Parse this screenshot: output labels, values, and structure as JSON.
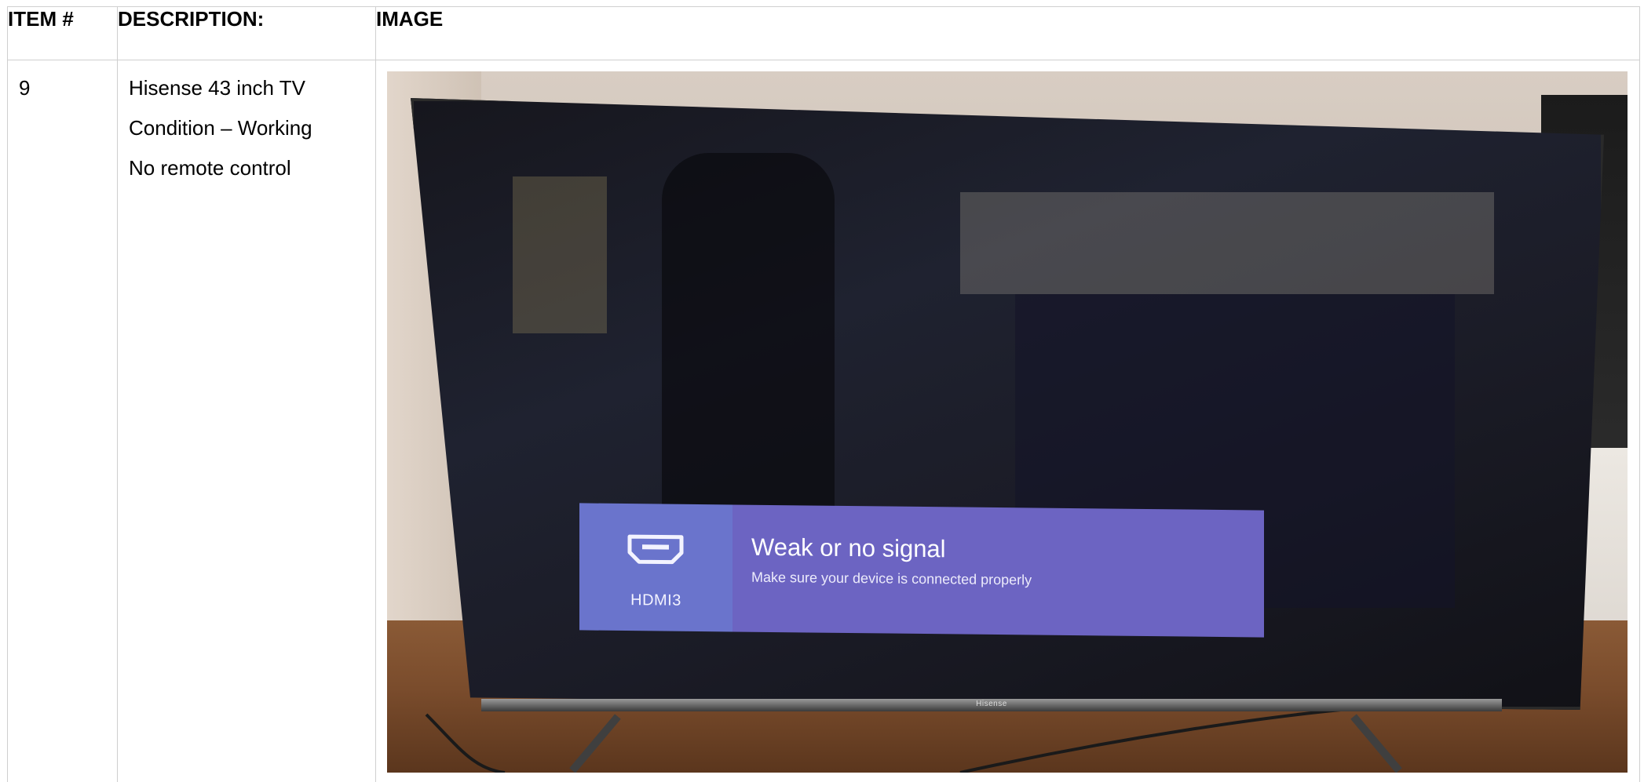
{
  "table": {
    "headers": {
      "item": "ITEM #",
      "description": "DESCRIPTION:",
      "image": "IMAGE"
    },
    "rows": [
      {
        "item_number": "9",
        "description_lines": [
          "Hisense 43 inch TV",
          "Condition – Working",
          "No remote control"
        ],
        "photo": {
          "tv_screen": {
            "input_label": "HDMI3",
            "message_title": "Weak or no signal",
            "message_subtitle": "Make sure your device is connected properly",
            "brand_text": "Hisense"
          },
          "icons": [
            "hdmi-port-icon"
          ]
        }
      }
    ]
  },
  "colors": {
    "grid_border": "#cfcfcf",
    "overlay_port_bg": "#6a74cc",
    "overlay_message_bg": "#6c64c2"
  }
}
